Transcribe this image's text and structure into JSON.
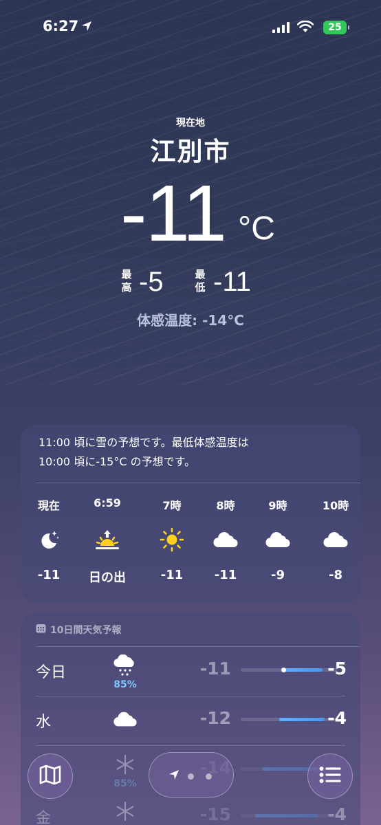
{
  "status_bar": {
    "time": "6:27",
    "battery": "25"
  },
  "current": {
    "location_label": "現在地",
    "city": "江別市",
    "temperature": "-11",
    "unit": "°C",
    "high_label": "最高",
    "high": "-5",
    "low_label": "最低",
    "low": "-11",
    "feels_like": "体感温度: -14°C"
  },
  "hourly": {
    "summary_line1": "11:00 頃に雪の予想です。最低体感温度は",
    "summary_line2": "10:00 頃に-15°C の予想です。",
    "items": [
      {
        "time": "現在",
        "icon": "moon-stars-icon",
        "temp": "-11"
      },
      {
        "time": "6:59",
        "icon": "sunrise-icon",
        "temp": "日の出"
      },
      {
        "time": "7時",
        "icon": "sun-icon",
        "temp": "-11"
      },
      {
        "time": "8時",
        "icon": "cloud-icon",
        "temp": "-11"
      },
      {
        "time": "9時",
        "icon": "cloud-icon",
        "temp": "-9"
      },
      {
        "time": "10時",
        "icon": "cloud-icon",
        "temp": "-8"
      }
    ]
  },
  "daily": {
    "header": "10日間天気予報",
    "items": [
      {
        "day": "今日",
        "icon": "cloud-snow-icon",
        "pop": "85%",
        "low": "-11",
        "high": "-5",
        "range": [
          0.45,
          0.85
        ],
        "dot": 0.44
      },
      {
        "day": "水",
        "icon": "cloud-icon",
        "pop": "",
        "low": "-12",
        "high": "-4",
        "range": [
          0.4,
          0.87
        ]
      },
      {
        "day": "",
        "icon": "snowflake-icon",
        "pop": "85%",
        "low": "-14",
        "high": "",
        "range": [
          0.22,
          0.8
        ]
      },
      {
        "day": "金",
        "icon": "snowflake-icon",
        "pop": "",
        "low": "-15",
        "high": "-4",
        "range": [
          0.15,
          0.8
        ]
      }
    ]
  }
}
